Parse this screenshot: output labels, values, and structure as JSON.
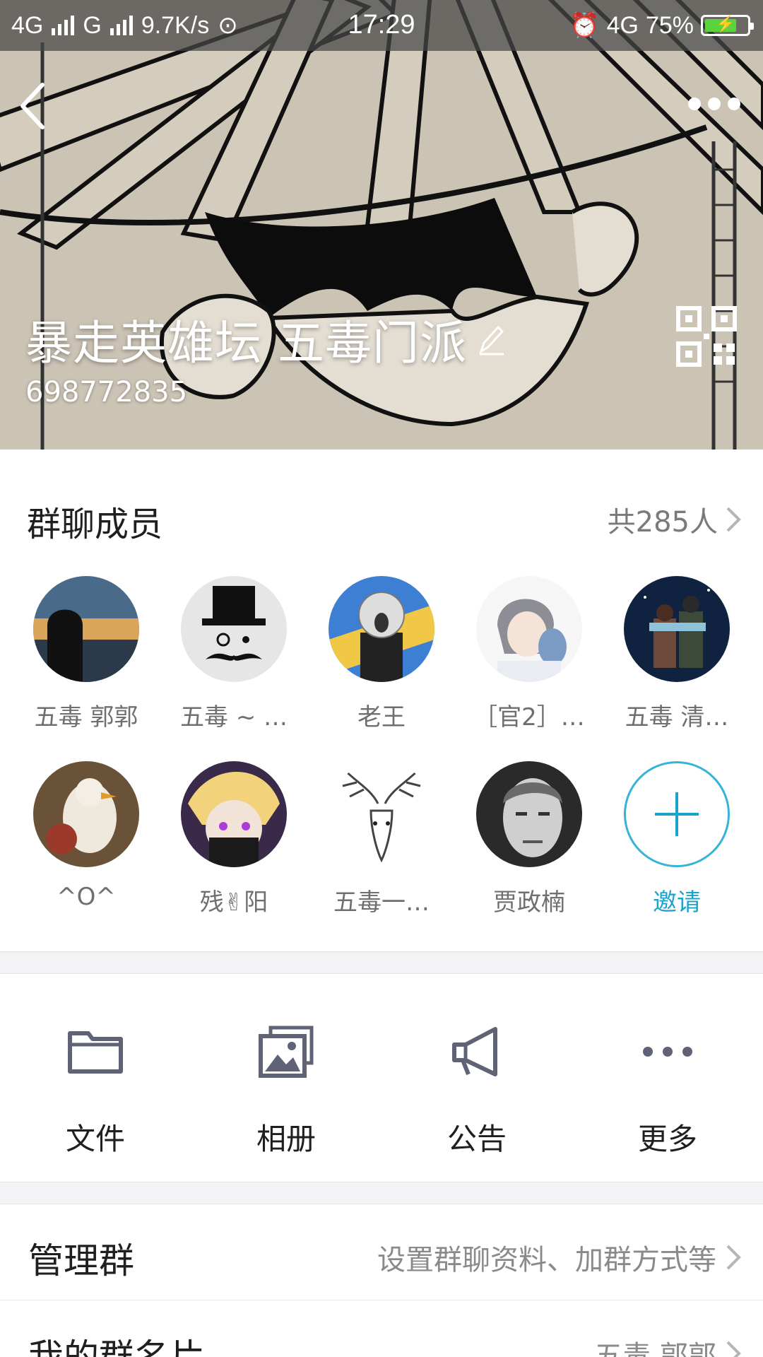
{
  "status_bar": {
    "network_left": "4G",
    "network_left2": "G",
    "speed": "9.7K/s",
    "time": "17:29",
    "network_right": "4G",
    "battery": "75%",
    "battery_level": 0.75
  },
  "header": {
    "group_name": "暴走英雄坛 五毒门派",
    "group_id": "698772835"
  },
  "members": {
    "title": "群聊成员",
    "count": "共285人",
    "items": [
      {
        "name": "五毒 郭郭"
      },
      {
        "name": "五毒 ~ …"
      },
      {
        "name": "老王"
      },
      {
        "name": "［官2］…"
      },
      {
        "name": "五毒  清…"
      },
      {
        "name": "^O^"
      },
      {
        "name": "残✌阳"
      },
      {
        "name": "五毒一…"
      },
      {
        "name": "贾政楠"
      }
    ],
    "invite_label": "邀请"
  },
  "functions": [
    {
      "label": "文件",
      "icon": "folder-icon"
    },
    {
      "label": "相册",
      "icon": "album-icon"
    },
    {
      "label": "公告",
      "icon": "megaphone-icon"
    },
    {
      "label": "更多",
      "icon": "more-icon"
    }
  ],
  "rows": [
    {
      "title": "管理群",
      "value": "设置群聊资料、加群方式等"
    },
    {
      "title": "我的群名片",
      "value": "五毒 郭郭"
    }
  ],
  "colors": {
    "accent": "#1aa3cf",
    "icon_gray": "#5f6375"
  }
}
